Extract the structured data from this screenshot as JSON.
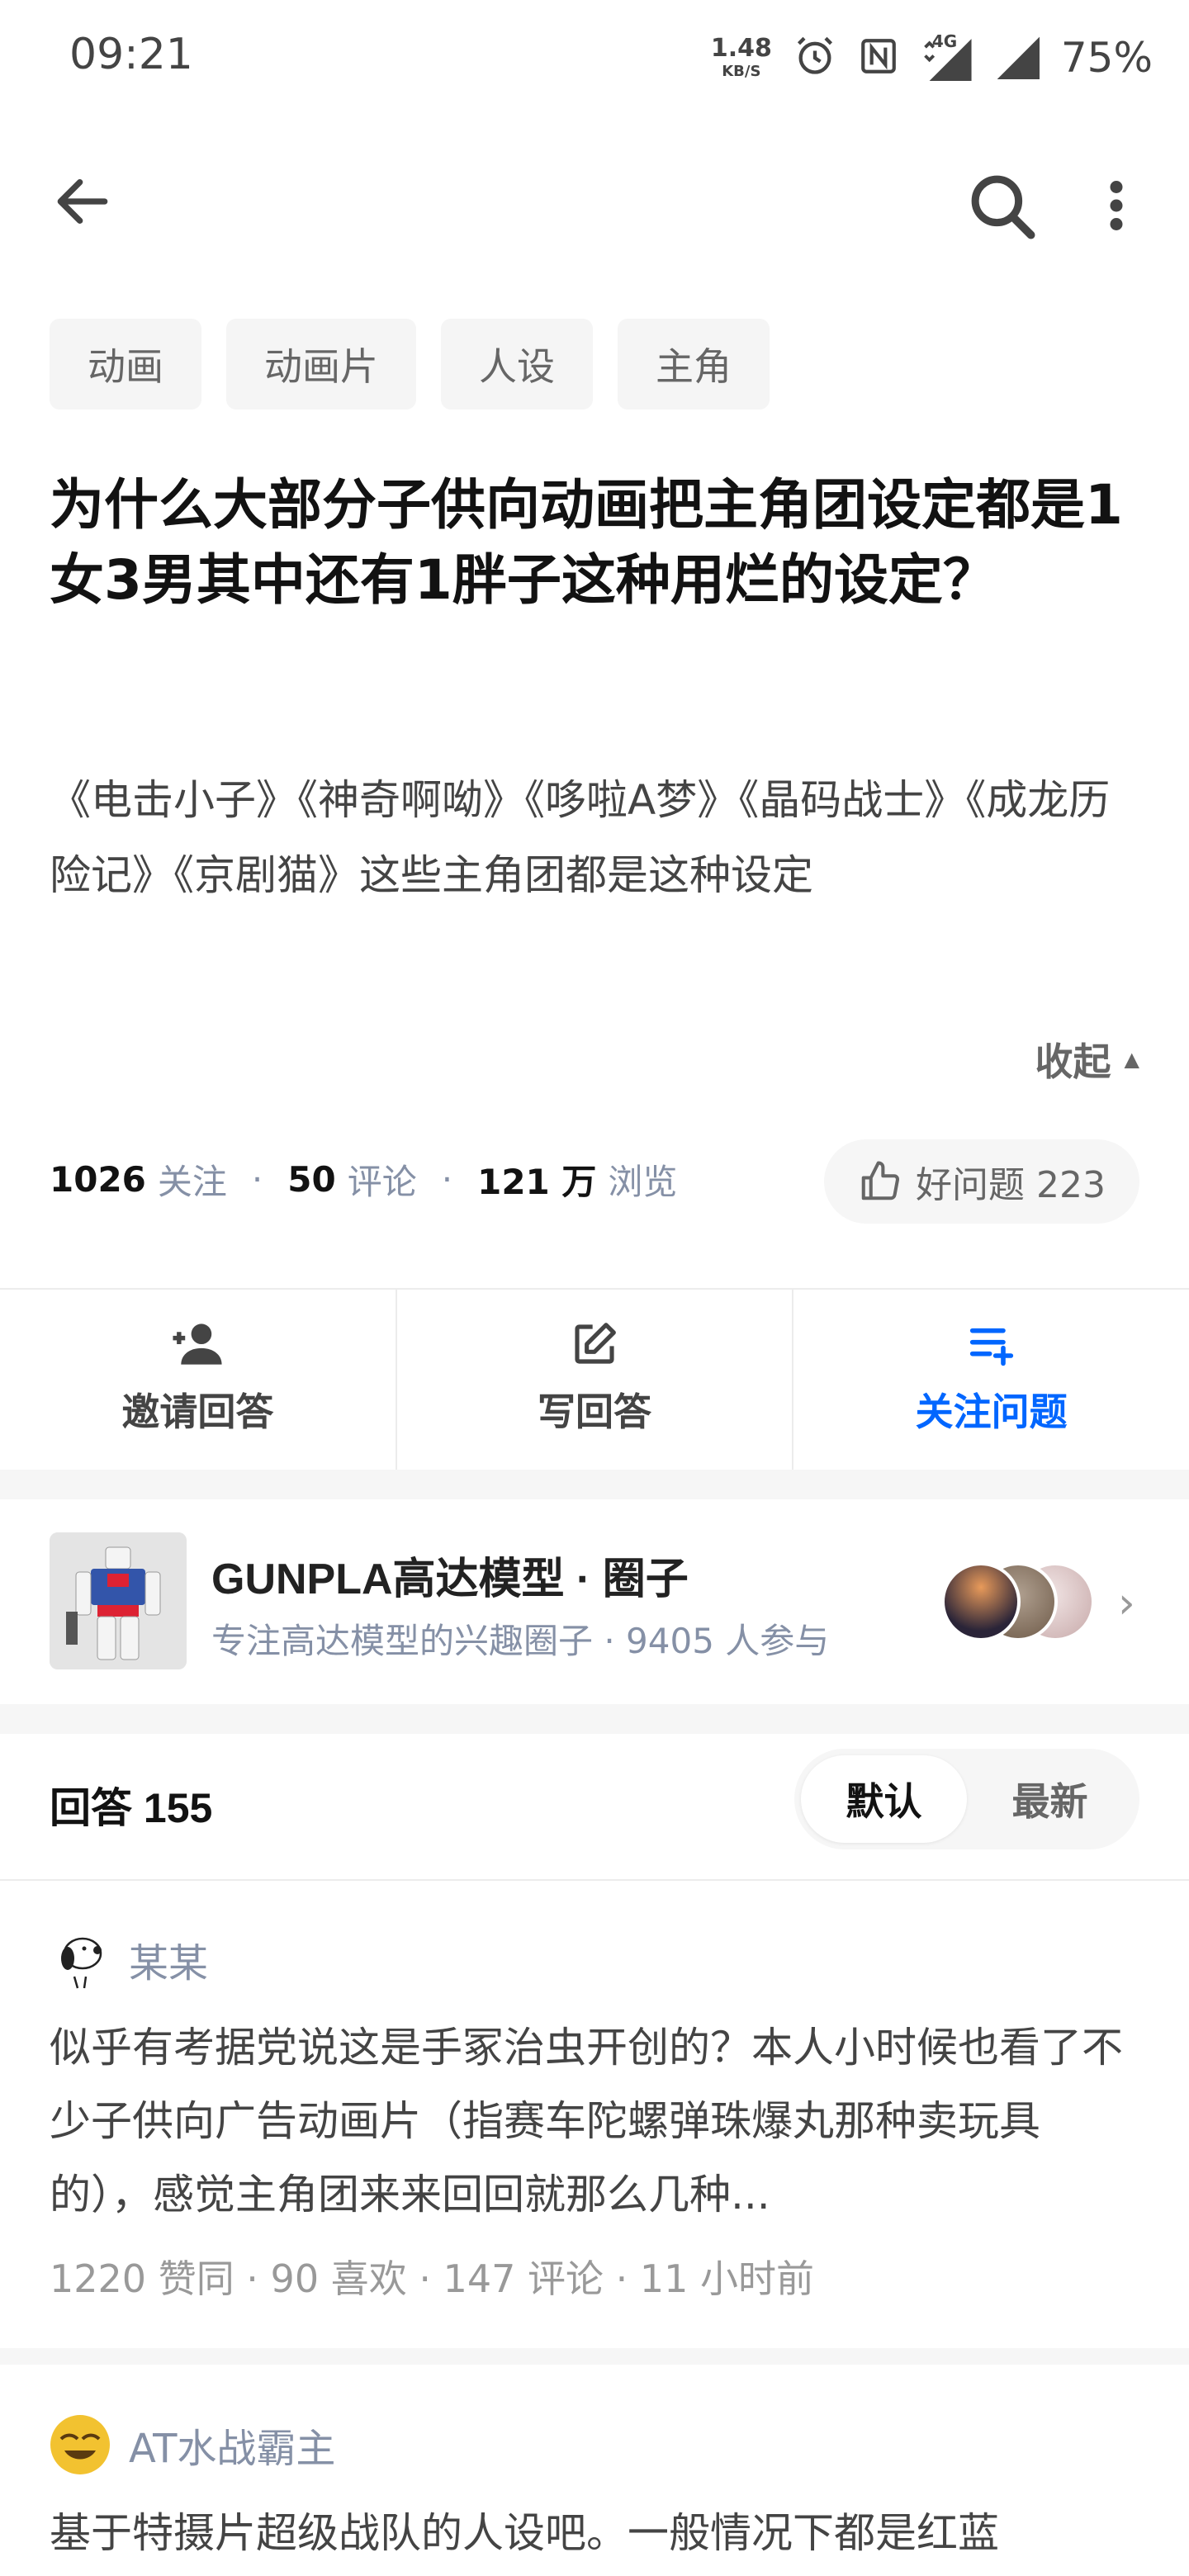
{
  "status_bar": {
    "time": "09:21",
    "net_speed_value": "1.48",
    "net_speed_unit": "KB/S",
    "network_type": "4G",
    "battery": "75%"
  },
  "tags": [
    "动画",
    "动画片",
    "人设",
    "主角"
  ],
  "question": {
    "title": "为什么大部分子供向动画把主角团设定都是1女3男其中还有1胖子这种用烂的设定？",
    "description": "《电击小子》《神奇啊呦》《哆啦A梦》《晶码战士》《成龙历险记》《京剧猫》这些主角团都是这种设定",
    "collapse_label": "收起"
  },
  "stats": {
    "followers_num": "1026",
    "followers_label": "关注",
    "comments_num": "50",
    "comments_label": "评论",
    "views_num": "121 万",
    "views_label": "浏览",
    "good_question_label": "好问题 223"
  },
  "actions": {
    "invite": "邀请回答",
    "write": "写回答",
    "follow": "关注问题"
  },
  "circle": {
    "name": "GUNPLA高达模型 · 圈子",
    "subtitle": "专注高达模型的兴趣圈子 · 9405 人参与"
  },
  "answers_header": {
    "title": "回答 155",
    "sort_default": "默认",
    "sort_latest": "最新"
  },
  "answers": [
    {
      "author": "某某",
      "text": "似乎有考据党说这是手冢治虫开创的？本人小时候也看了不少子供向广告动画片（指赛车陀螺弹珠爆丸那种卖玩具的），感觉主角团来来回回就那么几种...",
      "meta": "1220 赞同 · 90 喜欢 · 147 评论 · 11 小时前"
    },
    {
      "author": "AT水战霸主",
      "text": "基于特摄片超级战队的人设吧。一般情况下都是红蓝"
    }
  ],
  "colors": {
    "accent": "#0066ff",
    "secondary_text": "#8590a6"
  }
}
